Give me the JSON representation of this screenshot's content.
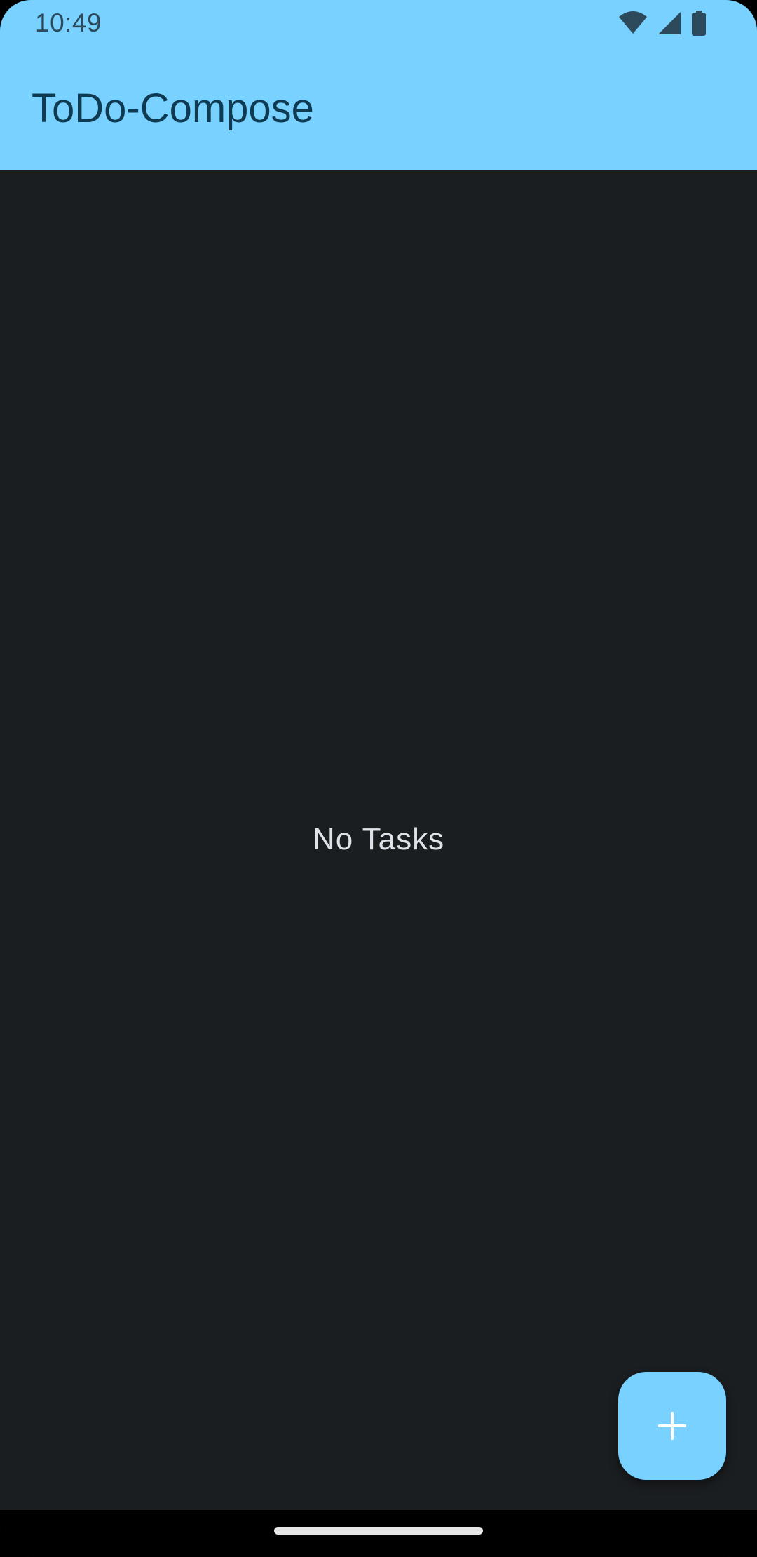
{
  "status_bar": {
    "time": "10:49",
    "icons": [
      "wifi-icon",
      "cellular-signal-icon",
      "battery-icon"
    ]
  },
  "app_bar": {
    "title": "ToDo-Compose"
  },
  "content": {
    "empty_message": "No Tasks"
  },
  "fab": {
    "icon": "plus-icon"
  },
  "colors": {
    "primary": "#78d1ff",
    "background": "#1b1e21",
    "on_primary": "#0e3a52",
    "on_background": "#dde3e8"
  }
}
